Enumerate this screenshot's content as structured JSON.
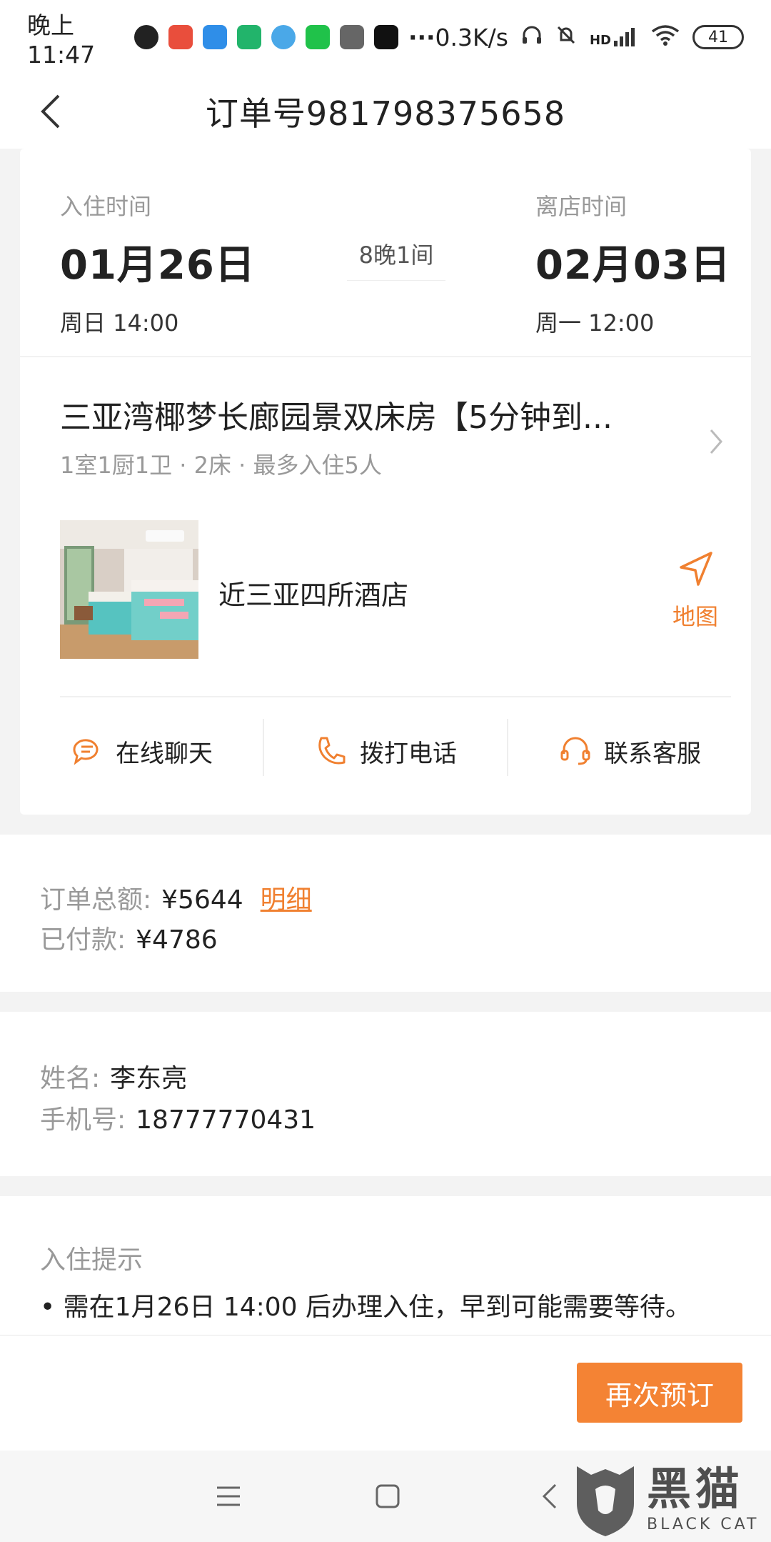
{
  "status_bar": {
    "time": "晚上11:47",
    "speed": "0.3K/s",
    "network": "HD",
    "battery": "41"
  },
  "header": {
    "title": "订单号981798375658"
  },
  "stay": {
    "checkin_label": "入住时间",
    "checkin_date": "01月26日",
    "checkin_time": "周日 14:00",
    "nights": "8晚1间",
    "checkout_label": "离店时间",
    "checkout_date": "02月03日",
    "checkout_time": "周一 12:00"
  },
  "room": {
    "title": "三亚湾椰梦长廊园景双床房【5分钟到...",
    "subtitle": "1室1厨1卫 · 2床 · 最多入住5人"
  },
  "hotel": {
    "location": "近三亚四所酒店",
    "map_label": "地图"
  },
  "actions": [
    {
      "label": "在线聊天",
      "icon": "chat-icon"
    },
    {
      "label": "拨打电话",
      "icon": "phone-icon"
    },
    {
      "label": "联系客服",
      "icon": "headset-icon"
    }
  ],
  "amount": {
    "total_label": "订单总额:",
    "total_value": "¥5644",
    "detail_link": "明细",
    "paid_label": "已付款:",
    "paid_value": "¥4786"
  },
  "contact": {
    "name_label": "姓名:",
    "name_value": "李东亮",
    "phone_label": "手机号:",
    "phone_value": "18777770431"
  },
  "tips": {
    "title": "入住提示",
    "item": "• 需在1月26日 14:00 后办理入住，早到可能需要等待。"
  },
  "bottom": {
    "rebook_label": "再次预订"
  },
  "watermark": {
    "cn": "黑猫",
    "en": "BLACK CAT"
  },
  "colors": {
    "accent": "#f48334",
    "link": "#f08030"
  }
}
